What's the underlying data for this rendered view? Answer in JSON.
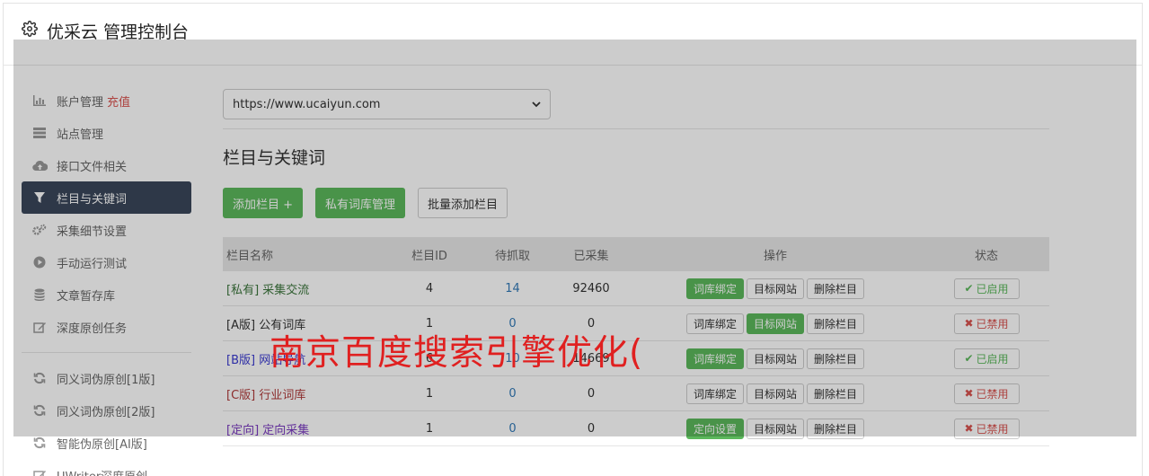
{
  "header": {
    "title": "优采云 管理控制台",
    "icon": "gear-icon"
  },
  "sidebar": {
    "items": [
      {
        "label": "账户管理",
        "extra": "充值",
        "icon": "bar-chart-icon"
      },
      {
        "label": "站点管理",
        "icon": "server-icon"
      },
      {
        "label": "接口文件相关",
        "icon": "cloud-upload-icon"
      },
      {
        "label": "栏目与关键词",
        "icon": "filter-icon",
        "active": true
      },
      {
        "label": "采集细节设置",
        "icon": "gears-icon"
      },
      {
        "label": "手动运行测试",
        "icon": "play-circle-icon"
      },
      {
        "label": "文章暂存库",
        "icon": "database-icon"
      },
      {
        "label": "深度原创任务",
        "icon": "edit-icon"
      }
    ],
    "items2": [
      {
        "label": "同义词伪原创[1版]",
        "icon": "refresh-icon"
      },
      {
        "label": "同义词伪原创[2版]",
        "icon": "refresh-icon"
      },
      {
        "label": "智能伪原创[AI版]",
        "icon": "refresh-icon"
      },
      {
        "label": "UWriter深度原创",
        "icon": "edit-icon"
      }
    ]
  },
  "main": {
    "site_select": {
      "value": "https://www.ucaiyun.com"
    },
    "section_title": "栏目与关键词",
    "buttons": {
      "add": "添加栏目 +",
      "private": "私有词库管理",
      "batch": "批量添加栏目"
    },
    "table": {
      "headers": {
        "name": "栏目名称",
        "id": "栏目ID",
        "wait": "待抓取",
        "done": "已采集",
        "ops": "操作",
        "status": "状态"
      },
      "rows": [
        {
          "tag": "[私有]",
          "name": "采集交流",
          "id": "4",
          "wait": "14",
          "done": "92460",
          "op1": "词库绑定",
          "op2": "目标网站",
          "op3": "删除栏目",
          "status": "已启用"
        },
        {
          "tag": "[A版]",
          "name": "公有词库",
          "id": "1",
          "wait": "0",
          "done": "0",
          "op1": "词库绑定",
          "op2": "目标网站",
          "op3": "删除栏目",
          "status": "已禁用"
        },
        {
          "tag": "[B版]",
          "name": "网站导航",
          "id": "6",
          "wait": "10",
          "done": "14669",
          "op1": "词库绑定",
          "op2": "目标网站",
          "op3": "删除栏目",
          "status": "已启用"
        },
        {
          "tag": "[C版]",
          "name": "行业词库",
          "id": "1",
          "wait": "0",
          "done": "0",
          "op1": "词库绑定",
          "op2": "目标网站",
          "op3": "删除栏目",
          "status": "已禁用"
        },
        {
          "tag": "[定向]",
          "name": "定向采集",
          "id": "1",
          "wait": "0",
          "done": "0",
          "op1": "定向设置",
          "op2": "目标网站",
          "op3": "删除栏目",
          "status": "已禁用"
        }
      ]
    }
  },
  "watermark": "南京百度搜索引擎优化(",
  "colors": {
    "green": "#5cb85c",
    "red": "#d9534f",
    "blue": "#337ab7",
    "sidebar_active": "#3a475b",
    "watermark": "#e02020"
  }
}
